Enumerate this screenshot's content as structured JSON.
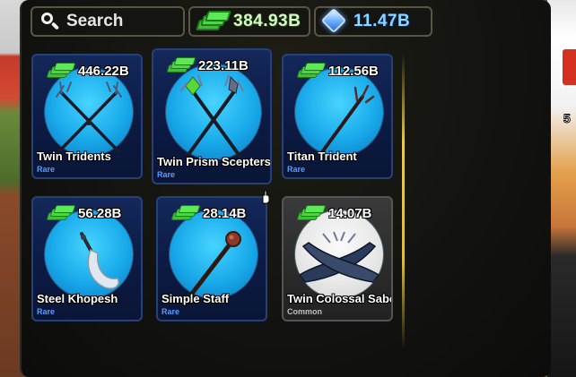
{
  "search": {
    "placeholder": "Search"
  },
  "currencies": {
    "cash": {
      "icon": "cash-stack-icon",
      "amount": "384.93B",
      "color": "#4dd546"
    },
    "gems": {
      "icon": "gem-icon",
      "amount": "11.47B",
      "color": "#7ab8ff"
    }
  },
  "rarity_colors": {
    "Rare": "#5a9cff",
    "Common": "#bfbfbf"
  },
  "items": [
    {
      "name": "Twin Tridents",
      "rarity": "Rare",
      "price": "446.22B",
      "icon": "twin-tridents-icon"
    },
    {
      "name": "Twin Prism Scepters",
      "rarity": "Rare",
      "price": "223.11B",
      "icon": "twin-prism-scepters-icon"
    },
    {
      "name": "Titan Trident",
      "rarity": "Rare",
      "price": "112.56B",
      "icon": "titan-trident-icon"
    },
    {
      "name": "Steel Khopesh",
      "rarity": "Rare",
      "price": "56.28B",
      "icon": "steel-khopesh-icon"
    },
    {
      "name": "Simple Staff",
      "rarity": "Rare",
      "price": "28.14B",
      "icon": "simple-staff-icon"
    },
    {
      "name": "Twin Colossal Sabers",
      "rarity": "Common",
      "price": "14.07B",
      "icon": "twin-colossal-sabers-icon"
    }
  ]
}
